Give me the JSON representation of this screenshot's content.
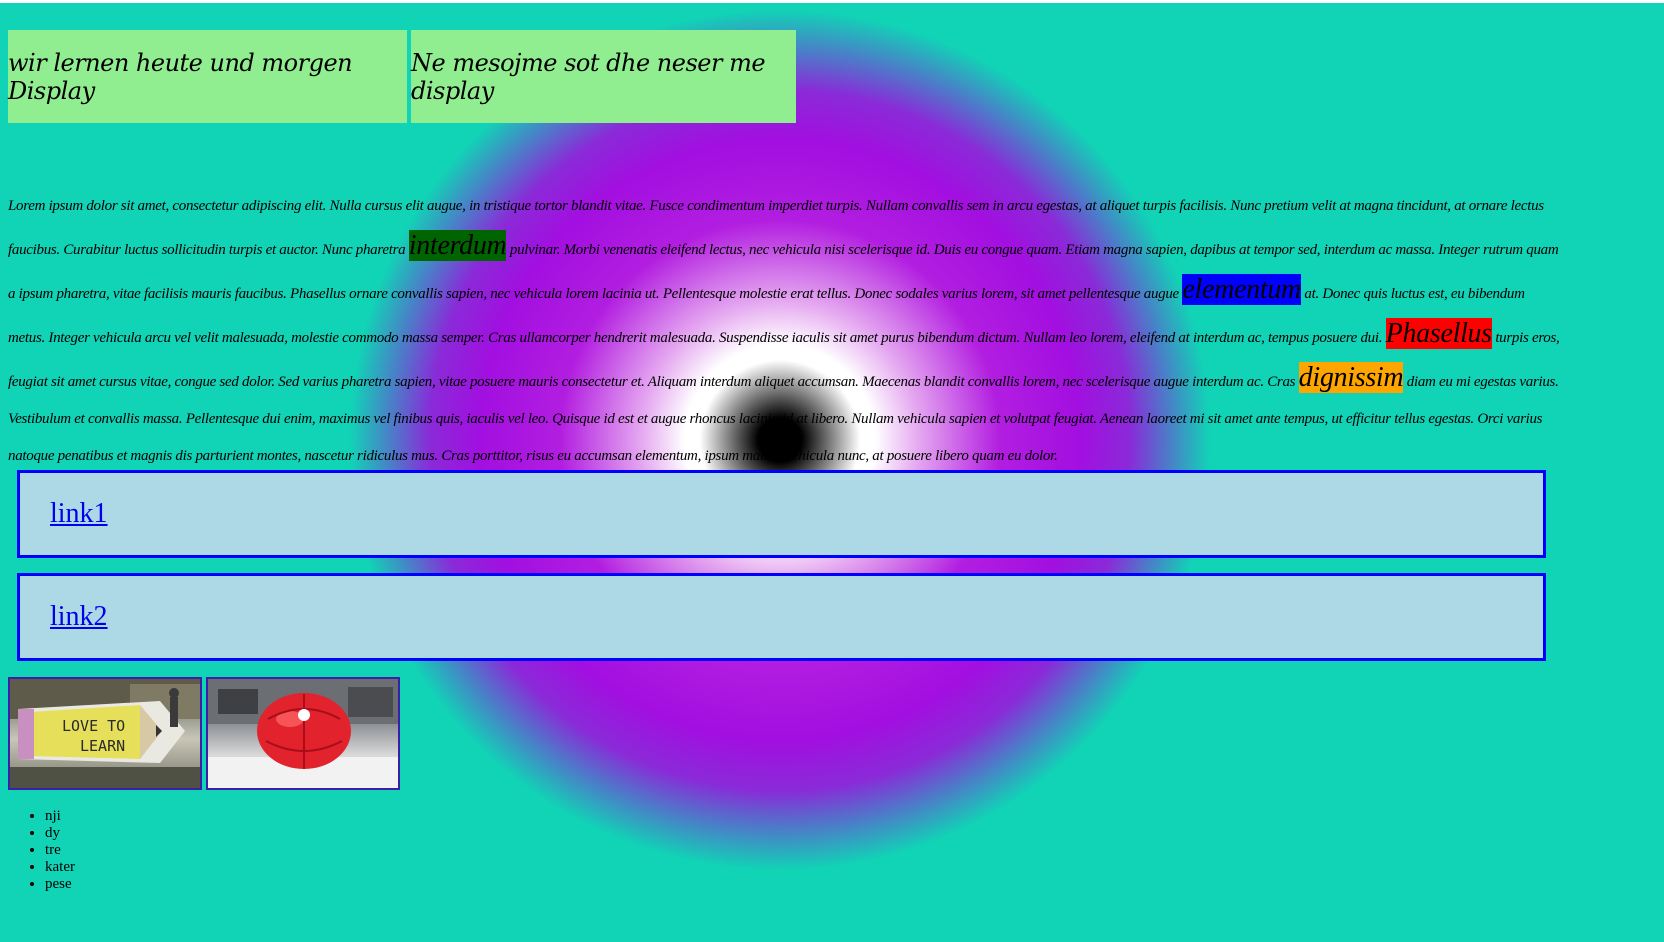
{
  "headers": {
    "left": "wir lernen heute und morgen Display",
    "right": "Ne mesojme sot dhe neser me display"
  },
  "paragraph": {
    "s1": "Lorem ipsum dolor sit amet, consectetur adipiscing elit. Nulla cursus elit augue, in tristique tortor blandit vitae. Fusce condimentum imperdiet turpis. Nullam convallis sem in arcu egestas, at aliquet turpis facilisis. Nunc pretium velit at magna tincidunt, at ornare lectus faucibus. Curabitur luctus sollicitudin turpis et auctor. Nunc pharetra",
    "hl1": "interdum",
    "s2": "pulvinar. Morbi venenatis eleifend lectus, nec vehicula nisi scelerisque id. Duis eu congue quam. Etiam magna sapien, dapibus at tempor sed, interdum ac massa. Integer rutrum quam a ipsum pharetra, vitae facilisis mauris faucibus. Phasellus ornare convallis sapien, nec vehicula lorem lacinia ut. Pellentesque molestie erat tellus. Donec sodales varius lorem, sit amet pellentesque augue",
    "hl2": "elementum",
    "s3": "at. Donec quis luctus est, eu bibendum metus. Integer vehicula arcu vel velit malesuada, molestie commodo massa semper. Cras ullamcorper hendrerit malesuada. Suspendisse iaculis sit amet purus bibendum dictum. Nullam leo lorem, eleifend at interdum ac, tempus posuere dui.",
    "hl3": "Phasellus",
    "s4": "turpis eros, feugiat sit amet cursus vitae, congue sed dolor. Sed varius pharetra sapien, vitae posuere mauris consectetur et. Aliquam interdum aliquet accumsan. Maecenas blandit convallis lorem, nec scelerisque augue interdum ac. Cras",
    "hl4": "dignissim",
    "s5": "diam eu mi egestas varius. Vestibulum et convallis massa. Pellentesque dui enim, maximus vel finibus quis, iaculis vel leo. Quisque id est et augue rhoncus lacinia id at libero. Nullam vehicula sapien et volutpat feugiat. Aenean laoreet mi sit amet ante tempus, ut efficitur tellus egestas. Orci varius natoque penatibus et magnis dis parturient montes, nascetur ridiculus mus. Cras porttitor, risus eu accumsan elementum, ipsum mauris vehicula nunc, at posuere libero quam eu dolor."
  },
  "links": [
    "link1",
    "link2"
  ],
  "images": {
    "pic1_text": "LOVE TO LEARN"
  },
  "list": [
    "nji",
    "dy",
    "tre",
    "kater",
    "pese"
  ],
  "colors": {
    "background": "#11d3b6",
    "header_box": "#90ee90",
    "link_box": "#add8e6",
    "link_border": "#0000ff",
    "hl_green": "#006400",
    "hl_blue": "#0000ff",
    "hl_red": "#ff0000",
    "hl_orange": "#ffa500"
  }
}
